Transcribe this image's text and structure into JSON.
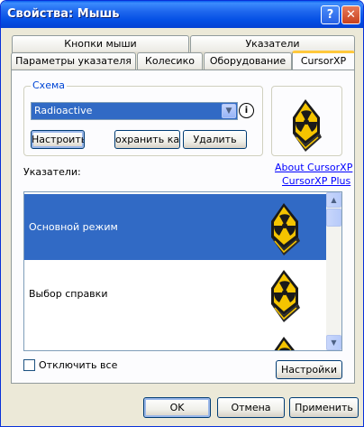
{
  "window": {
    "title": "Свойства: Мышь",
    "help_glyph": "?",
    "close_glyph": "✕"
  },
  "tabs": {
    "row1": [
      "Кнопки мыши",
      "Указатели"
    ],
    "row2": [
      "Параметры указателя",
      "Колесико",
      "Оборудование",
      "CursorXP"
    ],
    "active": "CursorXP"
  },
  "scheme": {
    "legend": "Схема",
    "selected": "Radioactive",
    "info_glyph": "i",
    "configure_label": "Настроить",
    "save_as_label": "охранить как",
    "delete_label": "Удалить"
  },
  "links": {
    "about": "About CursorXP",
    "plus": "CursorXP Plus"
  },
  "pointers": {
    "label": "Указатели:",
    "items": [
      {
        "name": "Основной режим",
        "selected": true
      },
      {
        "name": "Выбор справки",
        "selected": false
      },
      {
        "name": "",
        "selected": false
      }
    ]
  },
  "disable_all": {
    "label": "Отключить все",
    "checked": false
  },
  "settings_label": "Настройки",
  "footer": {
    "ok_label": "OK",
    "cancel_label": "Отмена",
    "apply_label": "Применить"
  },
  "colors": {
    "titlebar": "#0550e5",
    "selection": "#316ac5",
    "active_tab_accent": "#ffc83c",
    "cursor_yellow": "#f5c400"
  },
  "icons": [
    "radioactive-cursor-icon",
    "info-icon",
    "chevron-down-icon",
    "scroll-up-icon",
    "scroll-down-icon"
  ]
}
